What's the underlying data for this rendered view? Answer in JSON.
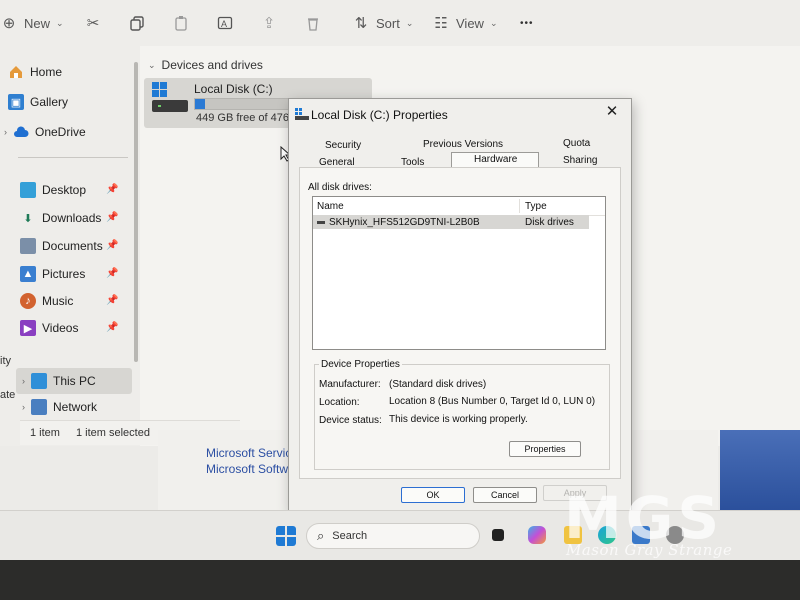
{
  "toolbar": {
    "new_label": "New",
    "sort_label": "Sort",
    "view_label": "View",
    "more_label": "•••"
  },
  "nav": {
    "items": [
      {
        "label": "Home"
      },
      {
        "label": "Gallery"
      },
      {
        "label": "OneDrive"
      },
      {
        "label": "Desktop"
      },
      {
        "label": "Downloads"
      },
      {
        "label": "Documents"
      },
      {
        "label": "Pictures"
      },
      {
        "label": "Music"
      },
      {
        "label": "Videos"
      },
      {
        "label": "This PC"
      },
      {
        "label": "Network"
      }
    ],
    "left_edge_1": "ity",
    "left_edge_2": "ate"
  },
  "content": {
    "section_label": "Devices and drives",
    "drive_name": "Local Disk (C:)",
    "drive_free": "449 GB free of 476",
    "drive_used_fraction": 0.06
  },
  "status_bar": {
    "count": "1 item",
    "selected": "1 item selected"
  },
  "lower_window": {
    "line1": "Microsoft Service",
    "line2": "Microsoft Softwa"
  },
  "dialog": {
    "title": "Local Disk (C:) Properties",
    "tabs_row1": [
      "Security",
      "Previous Versions",
      "Quota"
    ],
    "tabs_row2": [
      "General",
      "Tools",
      "Hardware",
      "Sharing"
    ],
    "active_tab": "Hardware",
    "all_disk_drives_label": "All disk drives:",
    "list_headers": {
      "name": "Name",
      "type": "Type"
    },
    "drive_row": {
      "name": "SKHynix_HFS512GD9TNI-L2B0B",
      "type": "Disk drives"
    },
    "device_properties_label": "Device Properties",
    "manufacturer_label": "Manufacturer:",
    "manufacturer_value": "(Standard disk drives)",
    "location_label": "Location:",
    "location_value": "Location 8 (Bus Number 0, Target Id 0, LUN 0)",
    "status_label": "Device status:",
    "status_value": "This device is working properly.",
    "properties_button": "Properties",
    "ok_button": "OK",
    "cancel_button": "Cancel",
    "apply_button": "Apply"
  },
  "taskbar": {
    "search_label": "Search"
  },
  "watermark": {
    "logo_text": "MGS",
    "caption": "Mason Gray Strange"
  }
}
